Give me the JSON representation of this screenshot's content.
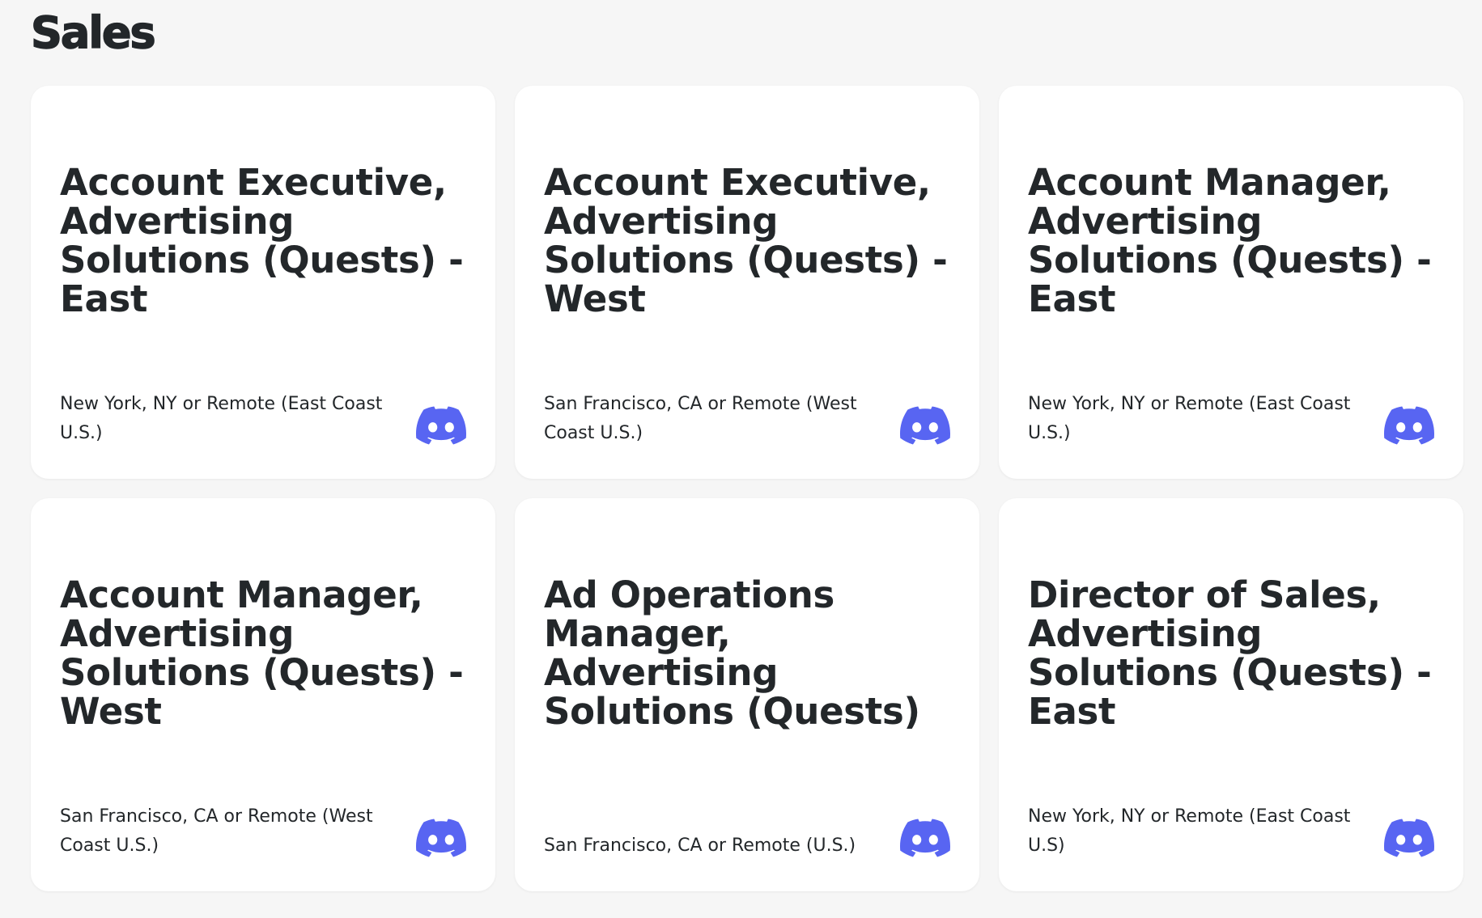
{
  "section": {
    "title": "Sales"
  },
  "colors": {
    "background": "#f6f6f6",
    "card": "#ffffff",
    "text": "#23272a",
    "discord_blurple": "#5865f2"
  },
  "jobs": [
    {
      "title": "Account Executive, Advertising Solutions (Quests) - East",
      "location": "New York, NY or Remote (East Coast U.S.)",
      "icon": "discord-logo-icon"
    },
    {
      "title": "Account Executive, Advertising Solutions (Quests) - West",
      "location": "San Francisco, CA or Remote (West Coast U.S.)",
      "icon": "discord-logo-icon"
    },
    {
      "title": "Account Manager, Advertising Solutions (Quests) - East",
      "location": "New York, NY or Remote (East Coast U.S.)",
      "icon": "discord-logo-icon"
    },
    {
      "title": "Account Manager, Advertising Solutions (Quests) - West",
      "location": "San Francisco, CA or Remote (West Coast U.S.)",
      "icon": "discord-logo-icon"
    },
    {
      "title": "Ad Operations Manager, Advertising Solutions (Quests)",
      "location": "San Francisco, CA or Remote (U.S.)",
      "icon": "discord-logo-icon"
    },
    {
      "title": "Director of Sales, Advertising Solutions (Quests) - East",
      "location": "New York, NY or Remote (East Coast U.S)",
      "icon": "discord-logo-icon"
    }
  ]
}
